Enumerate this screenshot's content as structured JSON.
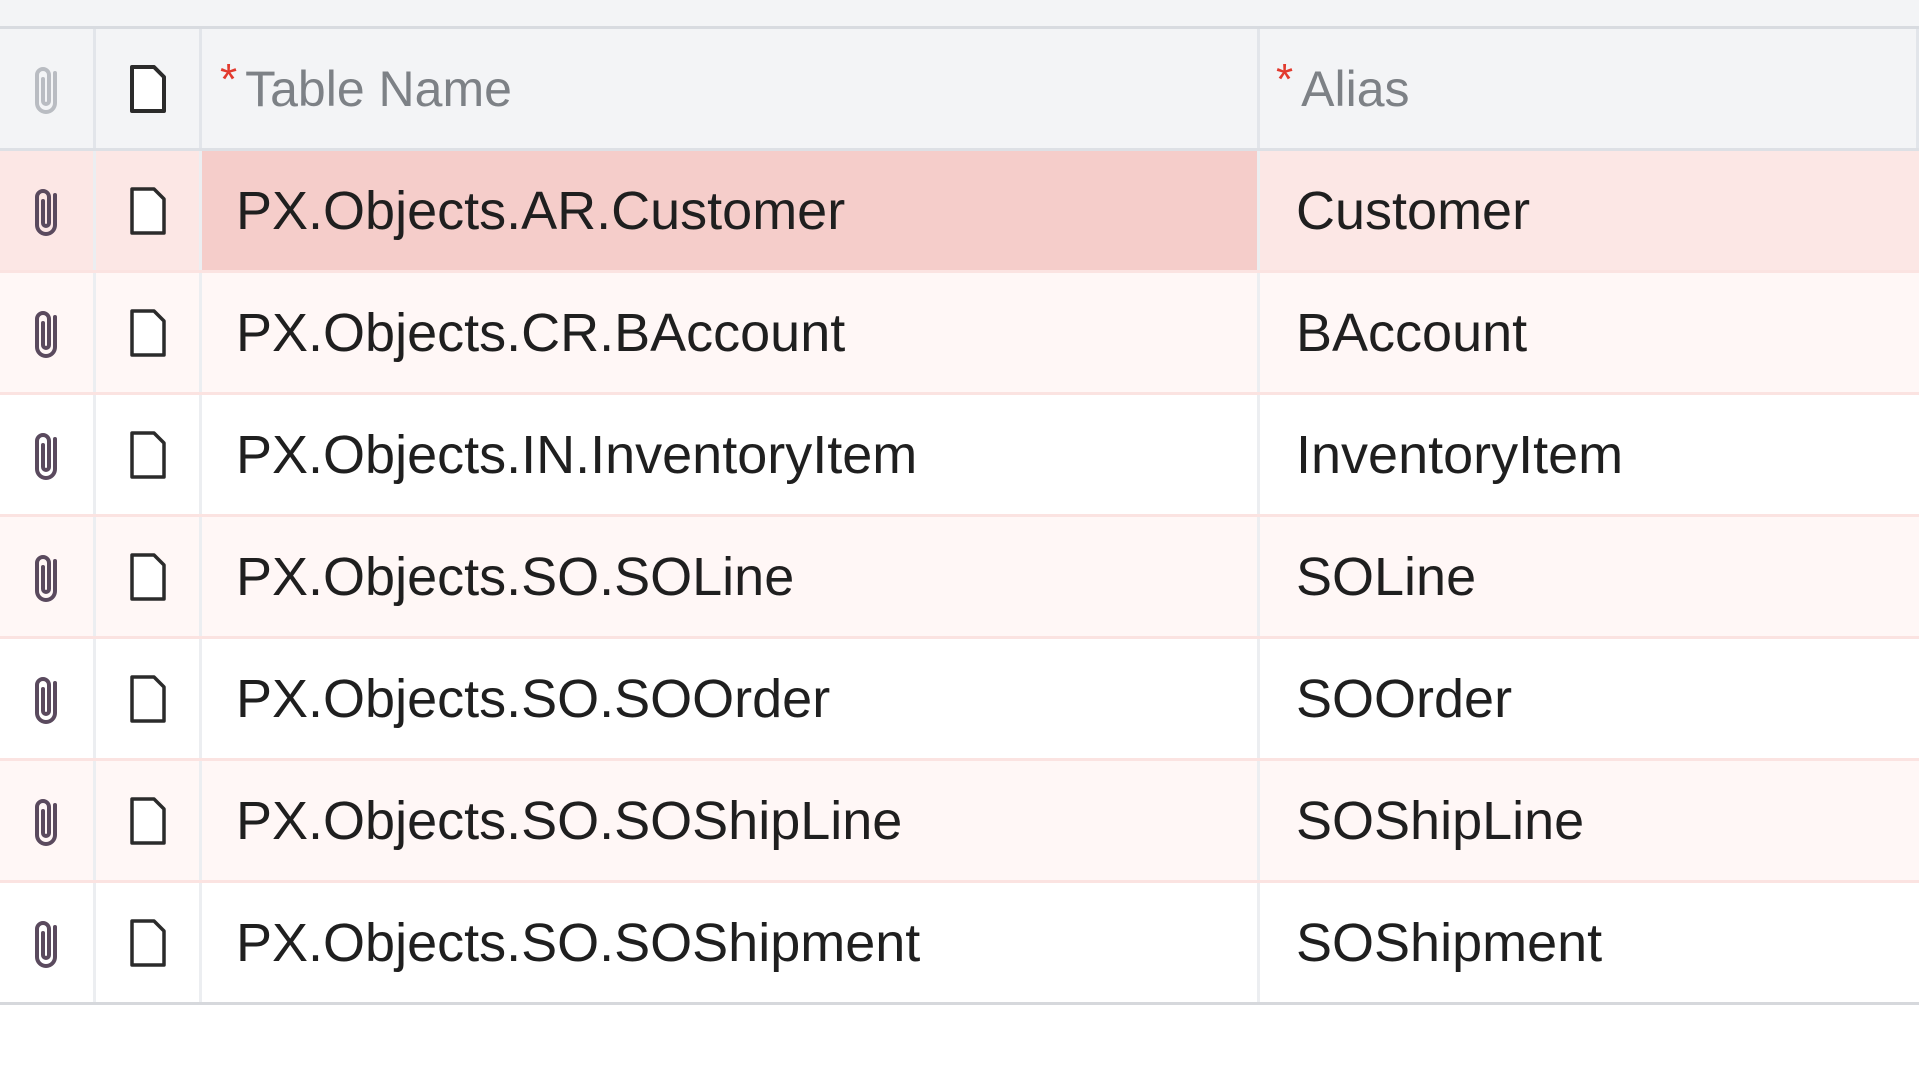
{
  "grid": {
    "columns": {
      "table_name": {
        "label": "Table Name",
        "required_mark": "*"
      },
      "alias": {
        "label": "Alias",
        "required_mark": "*"
      }
    },
    "rows": [
      {
        "table_name": "PX.Objects.AR.Customer",
        "alias": "Customer",
        "selected": true
      },
      {
        "table_name": "PX.Objects.CR.BAccount",
        "alias": "BAccount"
      },
      {
        "table_name": "PX.Objects.IN.InventoryItem",
        "alias": "InventoryItem"
      },
      {
        "table_name": "PX.Objects.SO.SOLine",
        "alias": "SOLine"
      },
      {
        "table_name": "PX.Objects.SO.SOOrder",
        "alias": "SOOrder"
      },
      {
        "table_name": "PX.Objects.SO.SOShipLine",
        "alias": "SOShipLine"
      },
      {
        "table_name": "PX.Objects.SO.SOShipment",
        "alias": "SOShipment"
      }
    ]
  },
  "icons": {
    "header_attachment": "paperclip-icon",
    "header_note": "note-icon",
    "row_attachment": "paperclip-icon",
    "row_note": "note-icon"
  },
  "colors": {
    "selected_row": "#fce7e5",
    "selected_cell": "#f5cdca",
    "alt_row": "#fff7f6",
    "required_mark": "#e23a2e",
    "header_bg": "#f3f4f6"
  }
}
